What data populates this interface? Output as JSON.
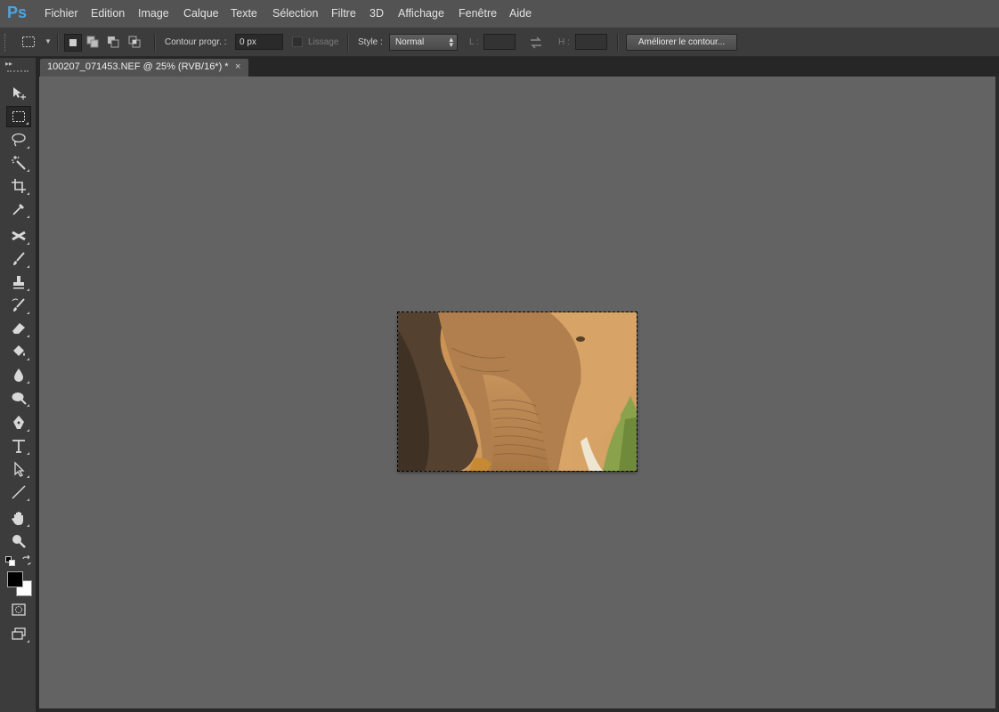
{
  "app": {
    "logo": "Ps"
  },
  "menu": [
    "Fichier",
    "Edition",
    "Image",
    "Calque",
    "Texte",
    "Sélection",
    "Filtre",
    "3D",
    "Affichage",
    "Fenêtre",
    "Aide"
  ],
  "options": {
    "feather_label": "Contour progr. :",
    "feather_value": "0 px",
    "antialias_label": "Lissage",
    "style_label": "Style :",
    "style_value": "Normal",
    "width_label": "L :",
    "height_label": "H :",
    "refine_button": "Améliorer le contour..."
  },
  "document": {
    "tab_title": "100207_071453.NEF @ 25% (RVB/16*) *",
    "close_glyph": "×"
  },
  "tools": [
    "move-tool",
    "rectangular-marquee-tool",
    "lasso-tool",
    "magic-wand-tool",
    "crop-tool",
    "eyedropper-tool",
    "spot-healing-tool",
    "brush-tool",
    "clone-stamp-tool",
    "history-brush-tool",
    "eraser-tool",
    "paint-bucket-tool",
    "blur-tool",
    "dodge-tool",
    "pen-tool",
    "type-tool",
    "path-selection-tool",
    "line-tool",
    "hand-tool",
    "zoom-tool"
  ],
  "colors": {
    "foreground": "#000000",
    "background": "#ffffff",
    "canvas": "#636363",
    "accent": "#4fa3e0"
  }
}
